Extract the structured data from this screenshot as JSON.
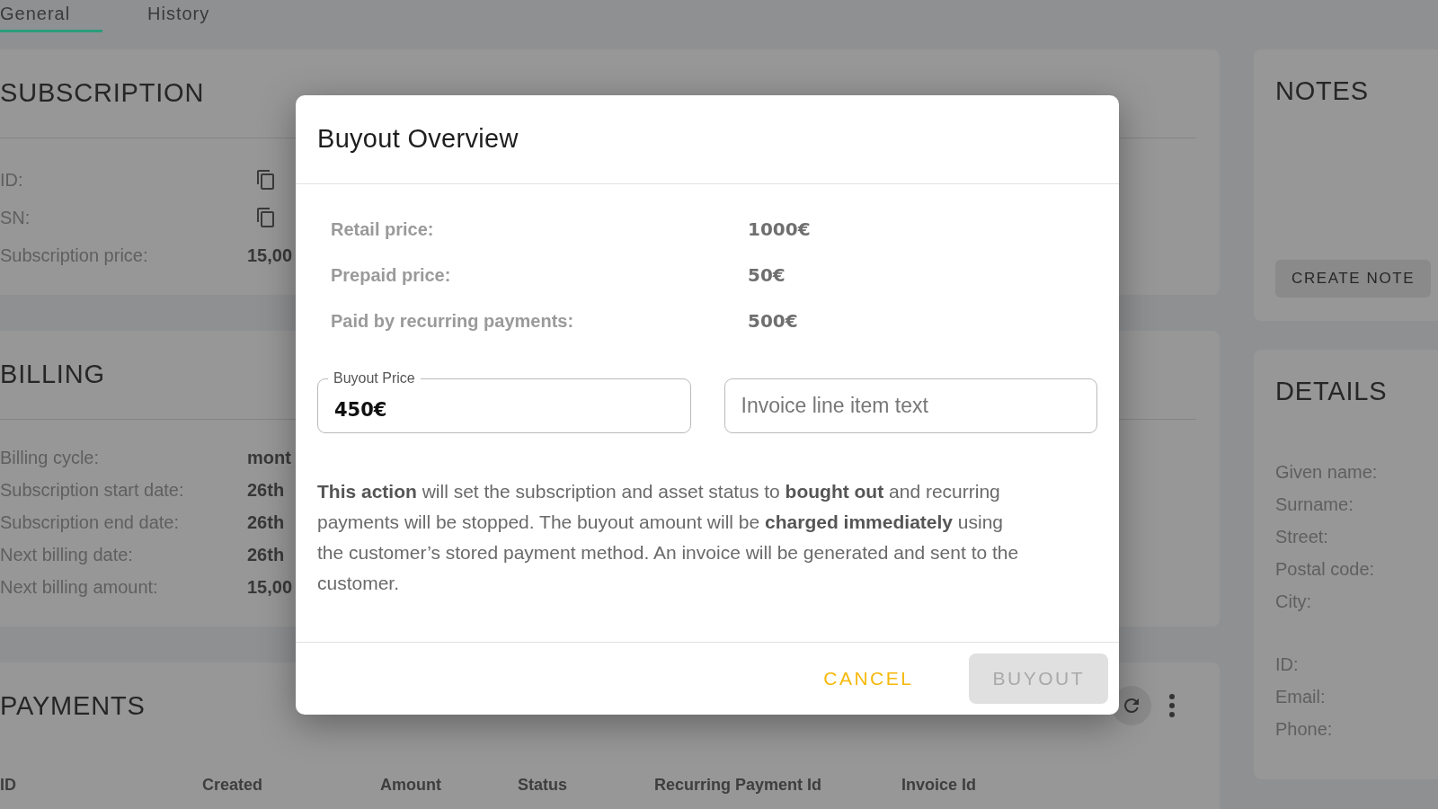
{
  "tabs": [
    {
      "label": "General",
      "selected": true
    },
    {
      "label": "History",
      "selected": false
    }
  ],
  "subscription": {
    "title": "SUBSCRIPTION",
    "rows": [
      {
        "label": "ID:",
        "kind": "copy"
      },
      {
        "label": "SN:",
        "kind": "copy"
      },
      {
        "label": "Subscription price:",
        "kind": "text",
        "value": "15,00"
      }
    ]
  },
  "billing": {
    "title": "BILLING",
    "rows": [
      {
        "label": "Billing cycle:",
        "kind": "text",
        "value": "mont"
      },
      {
        "label": "Subscription start date:",
        "kind": "text",
        "value": "26th"
      },
      {
        "label": "Subscription end date:",
        "kind": "text",
        "value": "26th"
      },
      {
        "label": "Next billing date:",
        "kind": "text",
        "value": "26th"
      },
      {
        "label": "Next billing amount:",
        "kind": "text",
        "value": "15,00"
      }
    ]
  },
  "payments": {
    "title": "PAYMENTS",
    "columns": [
      "ID",
      "Created",
      "Amount",
      "Status",
      "Recurring Payment Id",
      "Invoice Id"
    ]
  },
  "notes": {
    "title": "NOTES",
    "button": "CREATE NOTE"
  },
  "details": {
    "title": "DETAILS",
    "groups": [
      [
        "Given name:",
        "Surname:",
        "Street:",
        "Postal code:",
        "City:"
      ],
      [
        "ID:",
        "Email:",
        "Phone:"
      ]
    ]
  },
  "dialog": {
    "title": "Buyout Overview",
    "facts": [
      {
        "label": "Retail price:",
        "value": "1000€"
      },
      {
        "label": "Prepaid price:",
        "value": "50€"
      },
      {
        "label": "Paid by recurring payments:",
        "value": "500€"
      }
    ],
    "fields": [
      {
        "label": "Buyout Price",
        "value": "450€"
      },
      {
        "placeholder": "Invoice line item text"
      }
    ],
    "message": "**This action** will set the subscription and asset status to **bought out** and recurring payments will be stopped. The buyout amount will be **charged immediately** using the customer’s stored payment method. An invoice will be generated and sent to the customer.",
    "buttons": [
      {
        "label": "CANCEL",
        "kind": "text",
        "disabled": false
      },
      {
        "label": "BUYOUT",
        "kind": "contained",
        "disabled": true
      }
    ]
  }
}
